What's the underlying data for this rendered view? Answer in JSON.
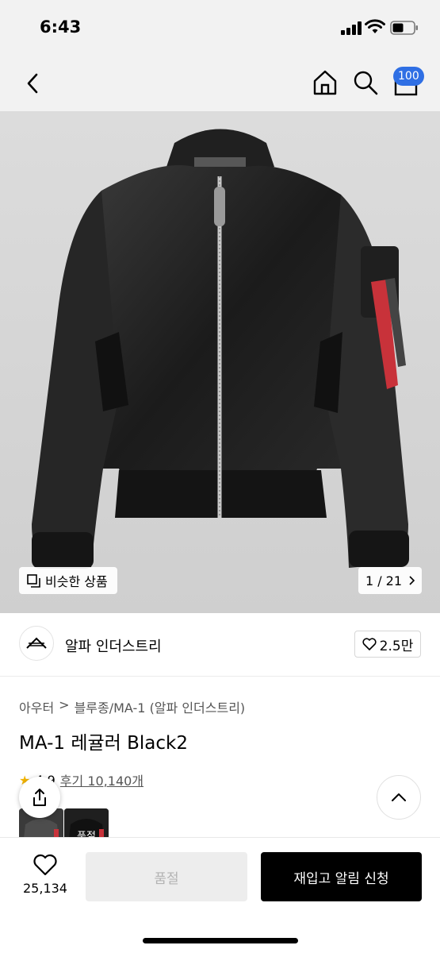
{
  "status": {
    "time": "6:43"
  },
  "nav": {
    "cart_count": "100"
  },
  "gallery": {
    "similar_label": "비슷한 상품",
    "counter": "1 / 21"
  },
  "brand": {
    "name": "알파 인더스트리",
    "likes": "2.5만"
  },
  "breadcrumb": {
    "category": "아우터",
    "sub_category": "블루종/MA-1 (알파 인더스트리)"
  },
  "product": {
    "title": "MA-1 레귤러 Black2",
    "rating": "4.9",
    "reviews": "후기 10,140개",
    "thumb_label": "품절"
  },
  "bottom": {
    "wish_count": "25,134",
    "soldout_label": "품절",
    "restock_label": "재입고 알림 신청"
  },
  "colors": {
    "accent": "#2f6fe4",
    "tag_red": "#c8323a",
    "primary": "#000000"
  }
}
